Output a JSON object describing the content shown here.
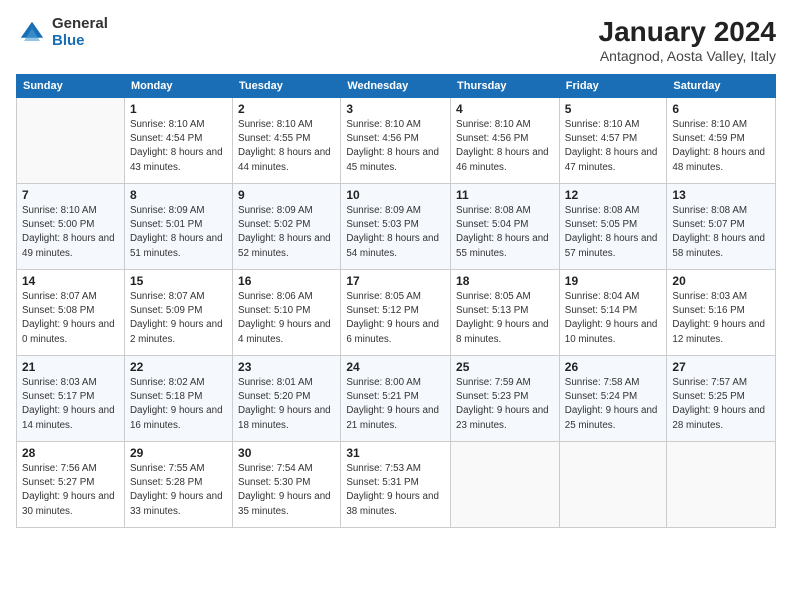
{
  "logo": {
    "general": "General",
    "blue": "Blue"
  },
  "title": "January 2024",
  "subtitle": "Antagnod, Aosta Valley, Italy",
  "days_of_week": [
    "Sunday",
    "Monday",
    "Tuesday",
    "Wednesday",
    "Thursday",
    "Friday",
    "Saturday"
  ],
  "weeks": [
    [
      {
        "day": "",
        "sunrise": "",
        "sunset": "",
        "daylight": ""
      },
      {
        "day": "1",
        "sunrise": "Sunrise: 8:10 AM",
        "sunset": "Sunset: 4:54 PM",
        "daylight": "Daylight: 8 hours and 43 minutes."
      },
      {
        "day": "2",
        "sunrise": "Sunrise: 8:10 AM",
        "sunset": "Sunset: 4:55 PM",
        "daylight": "Daylight: 8 hours and 44 minutes."
      },
      {
        "day": "3",
        "sunrise": "Sunrise: 8:10 AM",
        "sunset": "Sunset: 4:56 PM",
        "daylight": "Daylight: 8 hours and 45 minutes."
      },
      {
        "day": "4",
        "sunrise": "Sunrise: 8:10 AM",
        "sunset": "Sunset: 4:56 PM",
        "daylight": "Daylight: 8 hours and 46 minutes."
      },
      {
        "day": "5",
        "sunrise": "Sunrise: 8:10 AM",
        "sunset": "Sunset: 4:57 PM",
        "daylight": "Daylight: 8 hours and 47 minutes."
      },
      {
        "day": "6",
        "sunrise": "Sunrise: 8:10 AM",
        "sunset": "Sunset: 4:59 PM",
        "daylight": "Daylight: 8 hours and 48 minutes."
      }
    ],
    [
      {
        "day": "7",
        "sunrise": "Sunrise: 8:10 AM",
        "sunset": "Sunset: 5:00 PM",
        "daylight": "Daylight: 8 hours and 49 minutes."
      },
      {
        "day": "8",
        "sunrise": "Sunrise: 8:09 AM",
        "sunset": "Sunset: 5:01 PM",
        "daylight": "Daylight: 8 hours and 51 minutes."
      },
      {
        "day": "9",
        "sunrise": "Sunrise: 8:09 AM",
        "sunset": "Sunset: 5:02 PM",
        "daylight": "Daylight: 8 hours and 52 minutes."
      },
      {
        "day": "10",
        "sunrise": "Sunrise: 8:09 AM",
        "sunset": "Sunset: 5:03 PM",
        "daylight": "Daylight: 8 hours and 54 minutes."
      },
      {
        "day": "11",
        "sunrise": "Sunrise: 8:08 AM",
        "sunset": "Sunset: 5:04 PM",
        "daylight": "Daylight: 8 hours and 55 minutes."
      },
      {
        "day": "12",
        "sunrise": "Sunrise: 8:08 AM",
        "sunset": "Sunset: 5:05 PM",
        "daylight": "Daylight: 8 hours and 57 minutes."
      },
      {
        "day": "13",
        "sunrise": "Sunrise: 8:08 AM",
        "sunset": "Sunset: 5:07 PM",
        "daylight": "Daylight: 8 hours and 58 minutes."
      }
    ],
    [
      {
        "day": "14",
        "sunrise": "Sunrise: 8:07 AM",
        "sunset": "Sunset: 5:08 PM",
        "daylight": "Daylight: 9 hours and 0 minutes."
      },
      {
        "day": "15",
        "sunrise": "Sunrise: 8:07 AM",
        "sunset": "Sunset: 5:09 PM",
        "daylight": "Daylight: 9 hours and 2 minutes."
      },
      {
        "day": "16",
        "sunrise": "Sunrise: 8:06 AM",
        "sunset": "Sunset: 5:10 PM",
        "daylight": "Daylight: 9 hours and 4 minutes."
      },
      {
        "day": "17",
        "sunrise": "Sunrise: 8:05 AM",
        "sunset": "Sunset: 5:12 PM",
        "daylight": "Daylight: 9 hours and 6 minutes."
      },
      {
        "day": "18",
        "sunrise": "Sunrise: 8:05 AM",
        "sunset": "Sunset: 5:13 PM",
        "daylight": "Daylight: 9 hours and 8 minutes."
      },
      {
        "day": "19",
        "sunrise": "Sunrise: 8:04 AM",
        "sunset": "Sunset: 5:14 PM",
        "daylight": "Daylight: 9 hours and 10 minutes."
      },
      {
        "day": "20",
        "sunrise": "Sunrise: 8:03 AM",
        "sunset": "Sunset: 5:16 PM",
        "daylight": "Daylight: 9 hours and 12 minutes."
      }
    ],
    [
      {
        "day": "21",
        "sunrise": "Sunrise: 8:03 AM",
        "sunset": "Sunset: 5:17 PM",
        "daylight": "Daylight: 9 hours and 14 minutes."
      },
      {
        "day": "22",
        "sunrise": "Sunrise: 8:02 AM",
        "sunset": "Sunset: 5:18 PM",
        "daylight": "Daylight: 9 hours and 16 minutes."
      },
      {
        "day": "23",
        "sunrise": "Sunrise: 8:01 AM",
        "sunset": "Sunset: 5:20 PM",
        "daylight": "Daylight: 9 hours and 18 minutes."
      },
      {
        "day": "24",
        "sunrise": "Sunrise: 8:00 AM",
        "sunset": "Sunset: 5:21 PM",
        "daylight": "Daylight: 9 hours and 21 minutes."
      },
      {
        "day": "25",
        "sunrise": "Sunrise: 7:59 AM",
        "sunset": "Sunset: 5:23 PM",
        "daylight": "Daylight: 9 hours and 23 minutes."
      },
      {
        "day": "26",
        "sunrise": "Sunrise: 7:58 AM",
        "sunset": "Sunset: 5:24 PM",
        "daylight": "Daylight: 9 hours and 25 minutes."
      },
      {
        "day": "27",
        "sunrise": "Sunrise: 7:57 AM",
        "sunset": "Sunset: 5:25 PM",
        "daylight": "Daylight: 9 hours and 28 minutes."
      }
    ],
    [
      {
        "day": "28",
        "sunrise": "Sunrise: 7:56 AM",
        "sunset": "Sunset: 5:27 PM",
        "daylight": "Daylight: 9 hours and 30 minutes."
      },
      {
        "day": "29",
        "sunrise": "Sunrise: 7:55 AM",
        "sunset": "Sunset: 5:28 PM",
        "daylight": "Daylight: 9 hours and 33 minutes."
      },
      {
        "day": "30",
        "sunrise": "Sunrise: 7:54 AM",
        "sunset": "Sunset: 5:30 PM",
        "daylight": "Daylight: 9 hours and 35 minutes."
      },
      {
        "day": "31",
        "sunrise": "Sunrise: 7:53 AM",
        "sunset": "Sunset: 5:31 PM",
        "daylight": "Daylight: 9 hours and 38 minutes."
      },
      {
        "day": "",
        "sunrise": "",
        "sunset": "",
        "daylight": ""
      },
      {
        "day": "",
        "sunrise": "",
        "sunset": "",
        "daylight": ""
      },
      {
        "day": "",
        "sunrise": "",
        "sunset": "",
        "daylight": ""
      }
    ]
  ]
}
